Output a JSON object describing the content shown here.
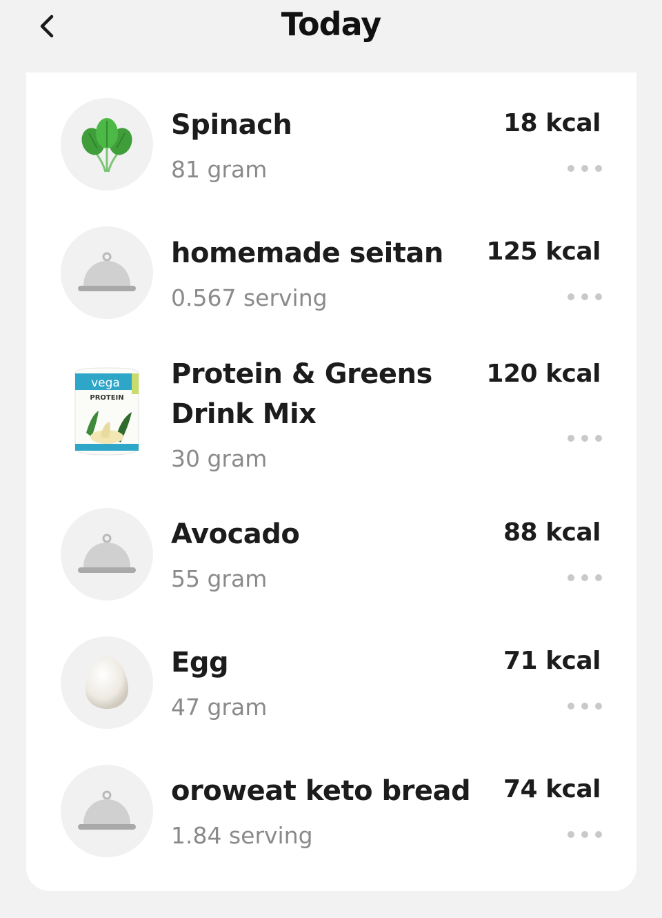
{
  "header": {
    "title": "Today",
    "back_icon": "chevron-left-icon"
  },
  "items": [
    {
      "name": "Spinach",
      "amount": "81 gram",
      "kcal": "18 kcal",
      "icon": "spinach-icon"
    },
    {
      "name": "homemade seitan",
      "amount": "0.567 serving",
      "kcal": "125 kcal",
      "icon": "food-cloche-icon"
    },
    {
      "name": "Protein & Greens Drink Mix",
      "amount": "30 gram",
      "kcal": "120 kcal",
      "icon": "vega-protein-product-image",
      "product_label": "vega",
      "product_sub": "PROTEIN"
    },
    {
      "name": "Avocado",
      "amount": "55 gram",
      "kcal": "88 kcal",
      "icon": "food-cloche-icon"
    },
    {
      "name": "Egg",
      "amount": "47 gram",
      "kcal": "71 kcal",
      "icon": "egg-icon"
    },
    {
      "name": "oroweat keto bread",
      "amount": "1.84 serving",
      "kcal": "74 kcal",
      "icon": "food-cloche-icon"
    }
  ],
  "colors": {
    "background": "#f2f2f2",
    "card": "#ffffff",
    "text_primary": "#1c1c1c",
    "text_secondary": "#8a8a8a",
    "thumb_bg": "#f1f1f1",
    "more_dots": "#c9c9c9"
  }
}
